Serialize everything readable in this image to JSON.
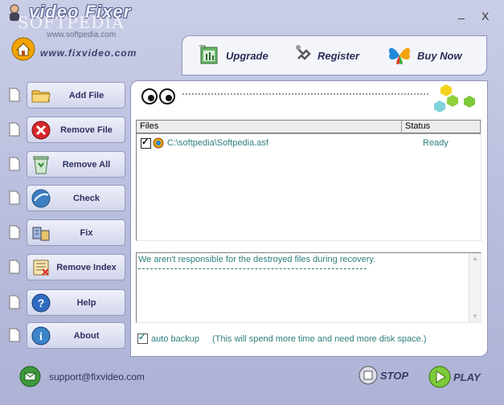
{
  "title": "video Fixer",
  "watermark": "SOFTPEDIA",
  "watermark_sub": "www.softpedia.com",
  "window": {
    "minimize": "_",
    "close": "X"
  },
  "site_url": "www.fixvideo.com",
  "topbar": {
    "upgrade": "Upgrade",
    "register": "Register",
    "buy_now": "Buy Now"
  },
  "sidebar": {
    "items": [
      {
        "label": "Add File",
        "icon": "folder-icon"
      },
      {
        "label": "Remove File",
        "icon": "remove-icon"
      },
      {
        "label": "Remove All",
        "icon": "recycle-bin-icon"
      },
      {
        "label": "Check",
        "icon": "check-icon"
      },
      {
        "label": "Fix",
        "icon": "fix-icon"
      },
      {
        "label": "Remove Index",
        "icon": "remove-index-icon"
      },
      {
        "label": "Help",
        "icon": "help-icon"
      },
      {
        "label": "About",
        "icon": "about-icon"
      }
    ]
  },
  "files": {
    "columns": [
      "Files",
      "Status"
    ],
    "rows": [
      {
        "checked": true,
        "path": "C:\\softpedia\\Softpedia.asf",
        "status": "Ready"
      }
    ]
  },
  "log": {
    "text": "We aren't responsible for the destroyed files during recovery."
  },
  "backup": {
    "checked": true,
    "label": "auto backup",
    "note": "(This will spend more time and need more disk space.)"
  },
  "footer": {
    "support": "support@fixvideo.com",
    "stop": "STOP",
    "play": "PLAY"
  },
  "colors": {
    "accent": "#2d7d7d",
    "background": "#c3c7e3",
    "panel": "#ffffff"
  }
}
